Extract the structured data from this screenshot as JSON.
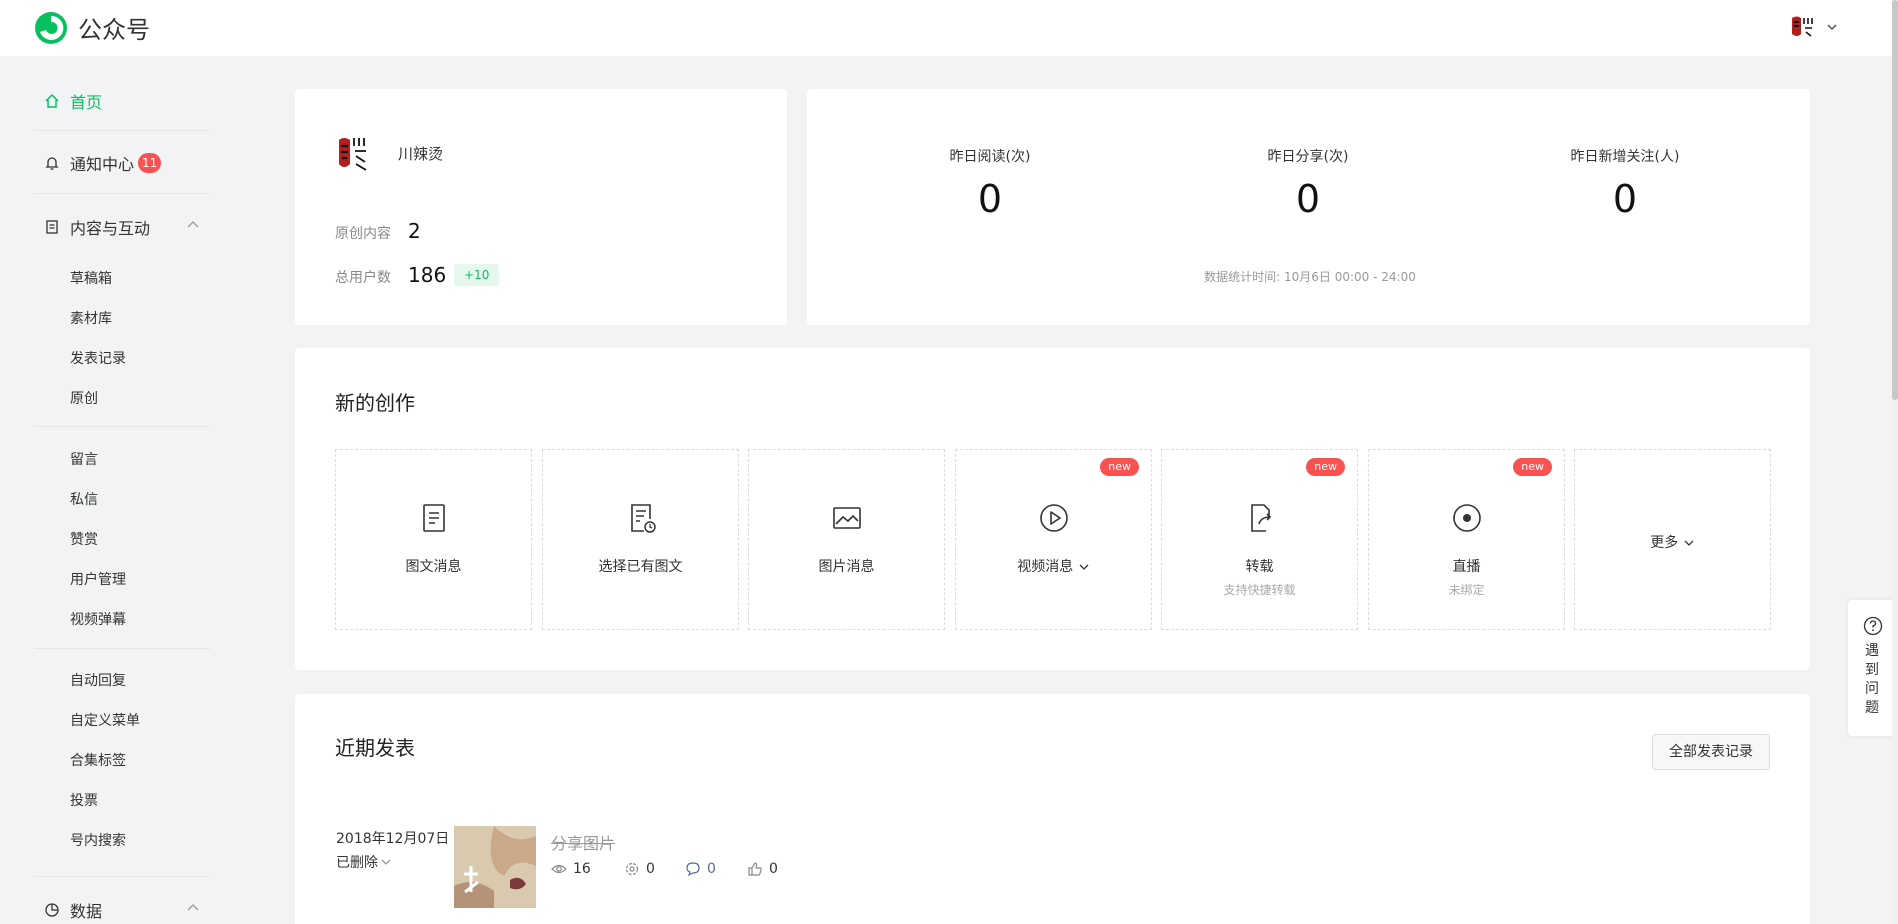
{
  "brand": {
    "name": "公众号"
  },
  "user": {
    "avatar_icon": "profile-avatar"
  },
  "sidebar": {
    "home": "首页",
    "notifications": {
      "label": "通知中心",
      "count": "11"
    },
    "content": {
      "label": "内容与互动",
      "items": [
        "草稿箱",
        "素材库",
        "发表记录",
        "原创"
      ]
    },
    "interaction_items": [
      "留言",
      "私信",
      "赞赏",
      "用户管理",
      "视频弹幕"
    ],
    "function_items": [
      "自动回复",
      "自定义菜单",
      "合集标签",
      "投票",
      "号内搜索"
    ],
    "data": {
      "label": "数据"
    }
  },
  "account": {
    "name": "川辣烫",
    "original_label": "原创内容",
    "original_count": "2",
    "users_label": "总用户数",
    "users_count": "186",
    "users_delta": "+10"
  },
  "overview": {
    "reads_label": "昨日阅读(次)",
    "reads_value": "0",
    "shares_label": "昨日分享(次)",
    "shares_value": "0",
    "follows_label": "昨日新增关注(人)",
    "follows_value": "0",
    "time_note": "数据统计时间: 10月6日 00:00 - 24:00"
  },
  "create": {
    "title": "新的创作",
    "tiles": [
      {
        "label": "图文消息",
        "icon": "document-icon"
      },
      {
        "label": "选择已有图文",
        "icon": "document-clock-icon"
      },
      {
        "label": "图片消息",
        "icon": "image-icon"
      },
      {
        "label": "视频消息",
        "icon": "play-circle-icon",
        "badge": "new"
      },
      {
        "label": "转载",
        "sub": "支持快捷转载",
        "icon": "share-doc-icon",
        "badge": "new"
      },
      {
        "label": "直播",
        "sub": "未绑定",
        "icon": "record-icon",
        "badge": "new"
      }
    ],
    "more": "更多"
  },
  "recent": {
    "title": "近期发表",
    "all_button": "全部发表记录",
    "post": {
      "date": "2018年12月07日",
      "status": "已删除",
      "title": "分享图片",
      "views": "16",
      "shares": "0",
      "comments": "0",
      "likes": "0"
    }
  },
  "help": {
    "label": "遇到问题"
  },
  "colors": {
    "accent": "#07c160",
    "badge_red": "#fa5151"
  }
}
